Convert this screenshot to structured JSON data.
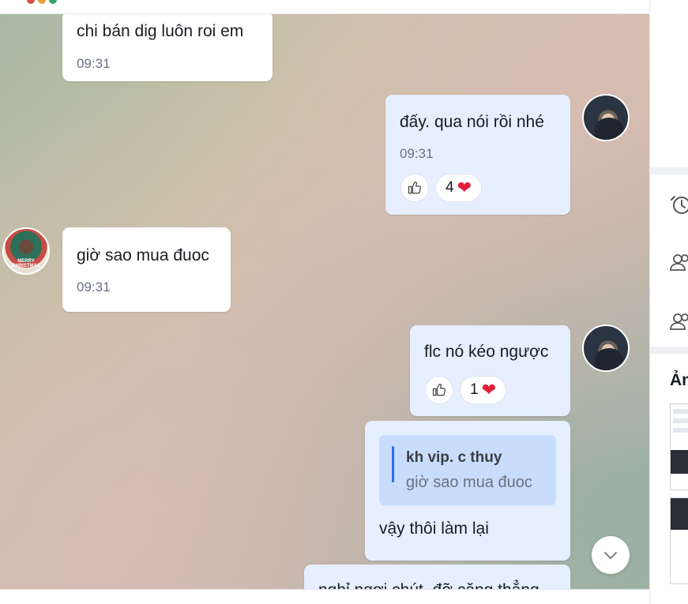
{
  "messages": [
    {
      "text": "chi bán dig luôn roi em",
      "time": "09:31"
    },
    {
      "text": "đấy. qua nói rồi nhé",
      "time": "09:31",
      "reaction_count": "4"
    },
    {
      "text": "giờ sao mua đuoc",
      "time": "09:31"
    },
    {
      "text": "flc nó kéo ngược",
      "reaction_count": "1"
    },
    {
      "quote_sender": "kh vip. c thuy",
      "quote_text": "giờ sao mua đuoc",
      "text": "vậy thôi làm lại"
    },
    {
      "text": "nghỉ ngơi chút, đỡ căng thẳng"
    }
  ],
  "avatar_label": "MERRY CHRISTMAS",
  "sidebar": {
    "section_title": "Ảnh"
  },
  "icons": [
    "clock-icon",
    "group-icon",
    "group-icon",
    "thumbs-up-icon",
    "heart-icon",
    "chevron-down-icon"
  ]
}
